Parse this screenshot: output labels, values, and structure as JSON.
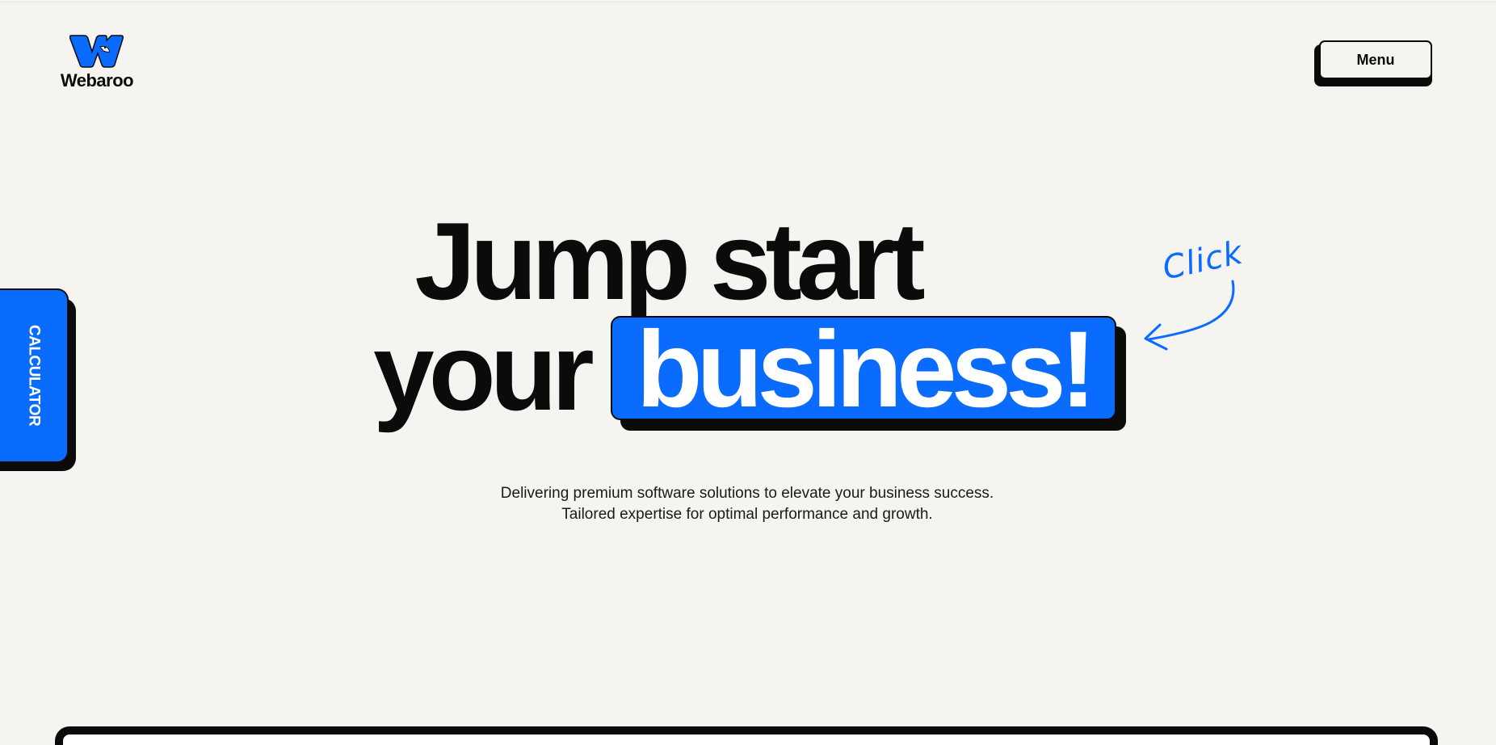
{
  "brand": {
    "name": "Webaroo",
    "logo_icon": "w-kangaroo-logo-icon",
    "accent_color": "#0a6cff"
  },
  "header": {
    "menu_label": "Menu"
  },
  "side_tab": {
    "label": "CALCULATOR"
  },
  "hero": {
    "line1": "Jump start",
    "line2_plain": "your",
    "line2_highlight": "business!",
    "annotation": "Click",
    "annotation_icon": "curved-arrow-icon"
  },
  "subtitle": {
    "line1": "Delivering premium software solutions to elevate your business success.",
    "line2": "Tailored expertise for optimal performance and growth."
  }
}
